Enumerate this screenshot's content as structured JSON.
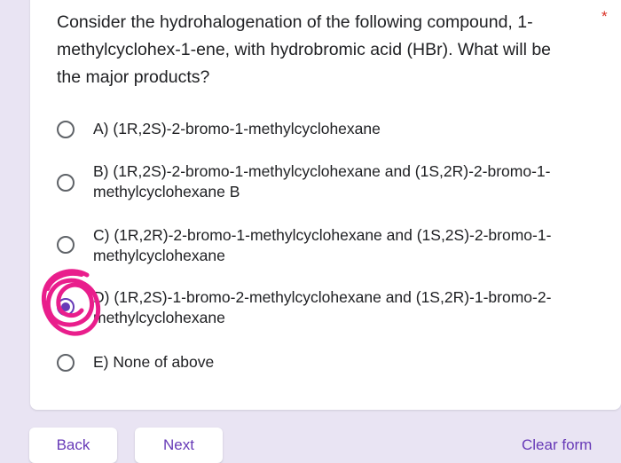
{
  "question": {
    "text": "Consider the hydrohalogenation of the following compound, 1-methylcyclohex-1-ene, with hydrobromic acid (HBr). What will be the major products?",
    "line1": "Consider the hydrohalogenation of the following compound, 1-",
    "line2": "methylcyclohex-1-ene, with hydrobromic acid (HBr). What will be",
    "line3": "the major products?",
    "required_marker": "*"
  },
  "options": [
    {
      "line1": "A) (1R,2S)-2-bromo-1-methylcyclohexane",
      "line2": "",
      "selected": false
    },
    {
      "line1": "B) (1R,2S)-2-bromo-1-methylcyclohexane and (1S,2R)-2-bromo-1-",
      "line2": "methylcyclohexane B",
      "selected": false
    },
    {
      "line1": "C) (1R,2R)-2-bromo-1-methylcyclohexane and (1S,2S)-2-bromo-1-",
      "line2": "methylcyclohexane",
      "selected": false
    },
    {
      "line1": "D) (1R,2S)-1-bromo-2-methylcyclohexane and (1S,2R)-1-bromo-2-",
      "line2": "methylcyclohexane",
      "selected": true
    },
    {
      "line1": "E) None of above",
      "line2": "",
      "selected": false
    }
  ],
  "nav": {
    "back_label": "Back",
    "next_label": "Next",
    "clear_label": "Clear form"
  },
  "colors": {
    "accent": "#673ab7",
    "required": "#d93025",
    "page_background": "#e9e4f3",
    "annotation": "#e91e8c"
  },
  "icons": {
    "annotation": "pink-circle-scribble"
  }
}
